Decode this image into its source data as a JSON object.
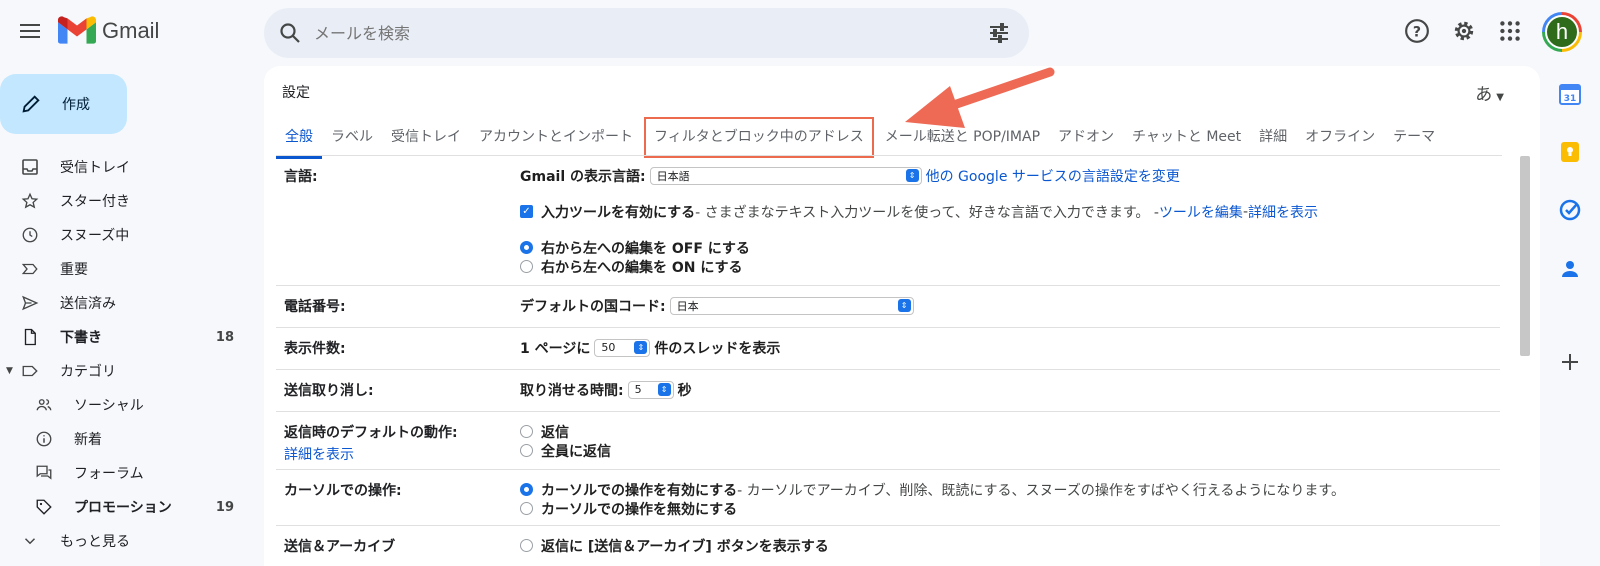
{
  "app": {
    "brand": "Gmail"
  },
  "search": {
    "placeholder": "メールを検索"
  },
  "compose": {
    "label": "作成"
  },
  "sidebar": {
    "items": [
      {
        "label": "受信トレイ",
        "icon": "inbox-icon"
      },
      {
        "label": "スター付き",
        "icon": "star-icon"
      },
      {
        "label": "スヌーズ中",
        "icon": "clock-icon"
      },
      {
        "label": "重要",
        "icon": "important-icon"
      },
      {
        "label": "送信済み",
        "icon": "send-icon"
      },
      {
        "label": "下書き",
        "icon": "draft-icon",
        "count": "18"
      },
      {
        "label": "カテゴリ",
        "icon": "label-icon"
      },
      {
        "label": "ソーシャル",
        "icon": "people-icon"
      },
      {
        "label": "新着",
        "icon": "info-icon"
      },
      {
        "label": "フォーラム",
        "icon": "forum-icon"
      },
      {
        "label": "プロモーション",
        "icon": "tag-icon",
        "count": "19"
      },
      {
        "label": "もっと見る",
        "icon": "expand-icon"
      }
    ]
  },
  "header": {
    "avatar_letter": "h"
  },
  "settings": {
    "title": "設定",
    "ime": "あ",
    "tabs": [
      "全般",
      "ラベル",
      "受信トレイ",
      "アカウントとインポート",
      "フィルタとブロック中のアドレス",
      "メール転送と POP/IMAP",
      "アドオン",
      "チャットと Meet",
      "詳細",
      "オフライン",
      "テーマ"
    ],
    "language": {
      "label": "言語:",
      "display_label": "Gmail の表示言語:",
      "display_value": "日本語",
      "other_link": "他の Google サービスの言語設定を変更",
      "input_tools": "入力ツールを有効にする",
      "input_tools_desc": " - さまざまなテキスト入力ツールを使って、好きな言語で入力できます。 - ",
      "edit_tools": "ツールを編集",
      "dash": " - ",
      "show_details": "詳細を表示",
      "rtl_off": "右から左への編集を OFF にする",
      "rtl_on": "右から左への編集を ON にする"
    },
    "phone": {
      "label": "電話番号:",
      "country_label": "デフォルトの国コード:",
      "country_value": "日本"
    },
    "page_size": {
      "label": "表示件数:",
      "prefix": "1 ページに",
      "value": "50",
      "suffix": "件のスレッドを表示"
    },
    "undo": {
      "label": "送信取り消し:",
      "prefix": "取り消せる時間:",
      "value": "5",
      "suffix": "秒"
    },
    "reply": {
      "label": "返信時のデフォルトの動作:",
      "details_link": "詳細を表示",
      "opt1": "返信",
      "opt2": "全員に返信"
    },
    "cursor": {
      "label": "カーソルでの操作:",
      "opt1": "カーソルでの操作を有効にする",
      "opt1_desc": " - カーソルでアーカイブ、削除、既読にする、スヌーズの操作をすばやく行えるようになります。",
      "opt2": "カーソルでの操作を無効にする"
    },
    "send_archive": {
      "label": "送信＆アーカイブ",
      "opt1": "返信に [送信＆アーカイブ] ボタンを表示する"
    }
  },
  "colors": {
    "accent": "#0b57d0",
    "highlight": "#ec6b4f",
    "compose_bg": "#c2e7ff"
  }
}
